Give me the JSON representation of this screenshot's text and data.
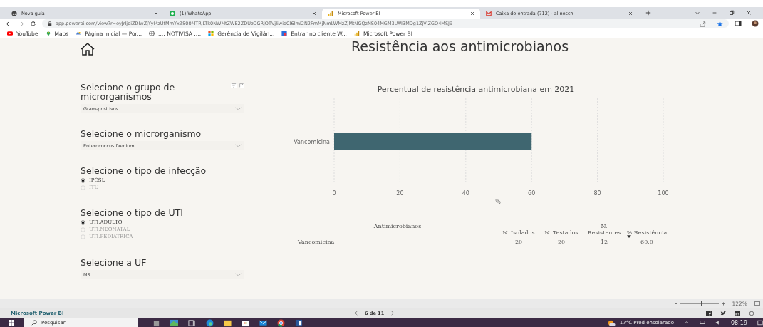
{
  "browser": {
    "tabs": [
      {
        "title": "Nova guia",
        "selected": false
      },
      {
        "title": "(1) WhatsApp",
        "selected": false
      },
      {
        "title": "Microsoft Power BI",
        "selected": true
      },
      {
        "title": "Caixa de entrada (712) - alinesch",
        "selected": false
      }
    ],
    "url": "app.powerbi.com/view?r=eyJrIjoiZDIwZjYyMzUtMmYxZS00MTRjLTk0NWMtZWE2ZDUzOGRjOTVjIiwidCI6ImI2N2FmMjNmLWMzZjMtNGQzNS04MGM3LWI3MDg1ZjVlZGQ4MSJ9",
    "bookmarks": [
      "YouTube",
      "Maps",
      "Página inicial — Por...",
      "..:: NOTIVISA ::..",
      "Gerência de Vigilân...",
      "Entrar no cliente W...",
      "Microsoft Power BI"
    ]
  },
  "report": {
    "title": "Resistência aos antimicrobianos",
    "filters": [
      {
        "kind": "dropdown",
        "label": "Selecione o grupo de microrganismos",
        "value": "Gram-positivos"
      },
      {
        "kind": "dropdown",
        "label": "Selecione o microrganismo",
        "value": "Enterococcus faecium"
      },
      {
        "kind": "radio",
        "label": "Selecione o tipo de infecção",
        "options": [
          {
            "label": "IPCSL",
            "selected": true
          },
          {
            "label": "ITU",
            "selected": false
          }
        ]
      },
      {
        "kind": "radio",
        "label": "Selecione o tipo de UTI",
        "options": [
          {
            "label": "UTI.ADULTO",
            "selected": true
          },
          {
            "label": "UTI.NEONATAL",
            "selected": false
          },
          {
            "label": "UTI.PEDIATRICA",
            "selected": false
          }
        ]
      },
      {
        "kind": "dropdown",
        "label": "Selecione a UF",
        "value": "MS"
      }
    ],
    "chart_data": {
      "type": "bar",
      "orientation": "horizontal",
      "title": "Percentual de resistência antimicrobiana em 2021",
      "xlabel": "%",
      "categories": [
        "Vancomicina"
      ],
      "values": [
        60
      ],
      "xlim": [
        0,
        100
      ],
      "xticks": [
        0,
        20,
        40,
        60,
        80,
        100
      ],
      "grid": true
    },
    "table": {
      "columns": [
        "Antimicrobianos",
        "N. Isolados",
        "N. Testados",
        "N. Resistentes",
        "% Resistência"
      ],
      "rows": [
        [
          "Vancomicina",
          "20",
          "20",
          "12",
          "60,0"
        ]
      ]
    }
  },
  "footer": {
    "zoom_slider": {
      "level": 0.55,
      "reading": "122%"
    },
    "brand": "Microsoft Power BI",
    "page": "6 de 11"
  },
  "taskbar": {
    "search_placeholder": "Pesquisar",
    "weather": "17°C  Pred ensolarado",
    "time": "08:19"
  }
}
